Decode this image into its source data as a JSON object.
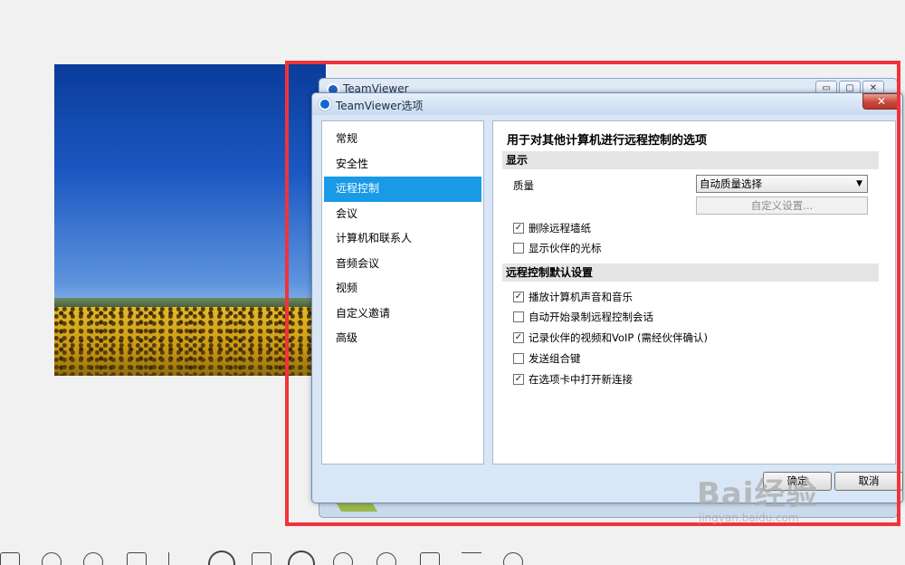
{
  "back_window": {
    "title": "TeamViewer",
    "controls": [
      "▭",
      "▢",
      "✕"
    ]
  },
  "dialog": {
    "title": "TeamViewer选项",
    "close_label": "✕",
    "nav": [
      {
        "label": "常规",
        "active": false
      },
      {
        "label": "安全性",
        "active": false
      },
      {
        "label": "远程控制",
        "active": true
      },
      {
        "label": "会议",
        "active": false
      },
      {
        "label": "计算机和联系人",
        "active": false
      },
      {
        "label": "音频会议",
        "active": false
      },
      {
        "label": "视频",
        "active": false
      },
      {
        "label": "自定义邀请",
        "active": false
      },
      {
        "label": "高级",
        "active": false
      }
    ],
    "heading": "用于对其他计算机进行远程控制的选项",
    "display_section": {
      "title": "显示",
      "quality_label": "质量",
      "quality_value": "自动质量选择",
      "custom_settings_label": "自定义设置...",
      "options": [
        {
          "label": "删除远程墙纸",
          "checked": true
        },
        {
          "label": "显示伙伴的光标",
          "checked": false
        }
      ]
    },
    "defaults_section": {
      "title": "远程控制默认设置",
      "options": [
        {
          "label": "播放计算机声音和音乐",
          "checked": true
        },
        {
          "label": "自动开始录制远程控制会话",
          "checked": false
        },
        {
          "label": "记录伙伴的视频和VoIP (需经伙伴确认)",
          "checked": true
        },
        {
          "label": "发送组合键",
          "checked": false
        },
        {
          "label": "在选项卡中打开新连接",
          "checked": true
        }
      ]
    },
    "ok_label": "确定",
    "cancel_label": "取消"
  },
  "watermark": {
    "main": "Bai经验",
    "sub": "jingyan.baidu.com"
  },
  "colors": {
    "highlight_box": "#f0333a",
    "nav_active": "#199ae6"
  }
}
